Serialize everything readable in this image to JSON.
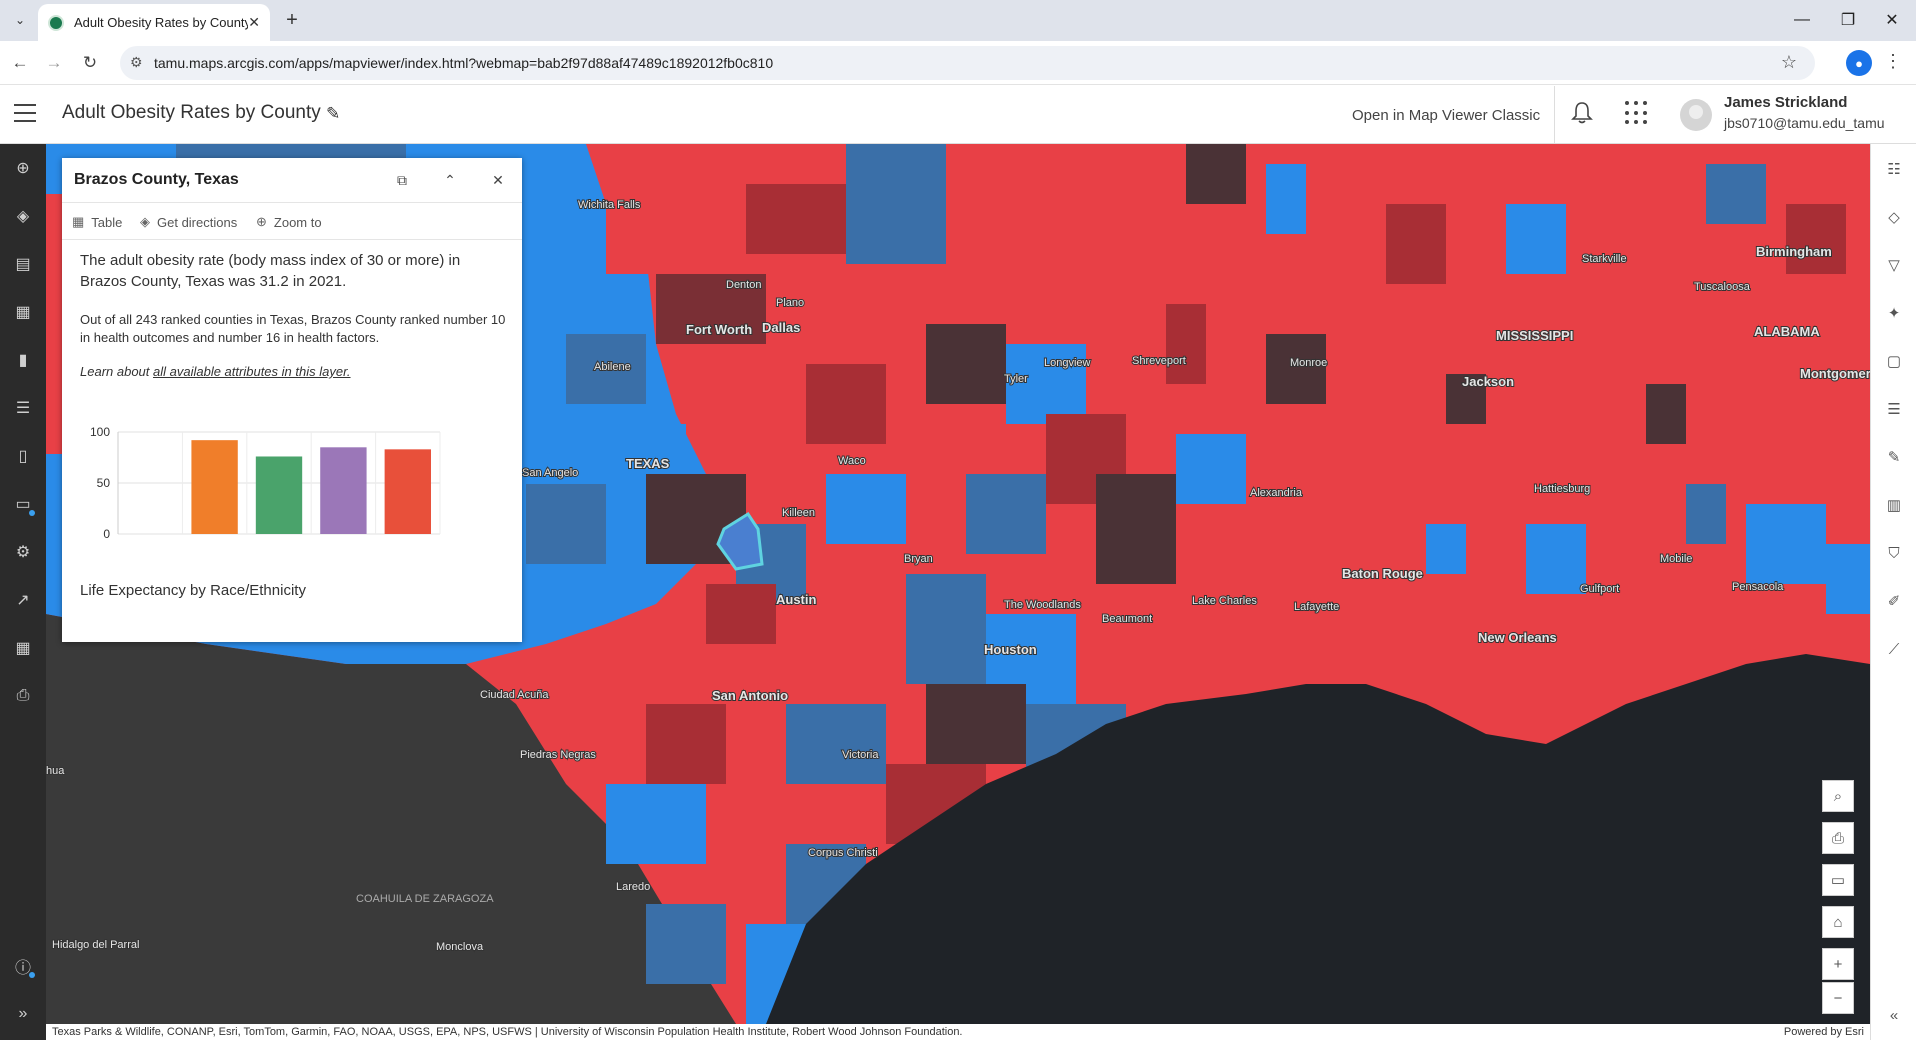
{
  "browser": {
    "tab_title": "Adult Obesity Rates by County",
    "url": "tamu.maps.arcgis.com/apps/mapviewer/index.html?webmap=bab2f97d88af47489c1892012fb0c810",
    "controls": {
      "back": "←",
      "forward": "→",
      "reload": "↻",
      "tab_menu": "⌄",
      "new_tab": "+",
      "close_tab": "✕",
      "minimize": "—",
      "restore": "❐",
      "close": "✕",
      "star": "☆",
      "menu": "⋮"
    }
  },
  "header": {
    "title": "Adult Obesity Rates by County",
    "open_classic": "Open in Map Viewer Classic",
    "user_name": "James Strickland",
    "user_email": "jbs0710@tamu.edu_tamu"
  },
  "left_toolbar": [
    "add-icon",
    "layers-icon",
    "table-icon",
    "basemap-icon",
    "charts-icon",
    "legend-icon",
    "bookmarks-icon",
    "save-icon",
    "settings-icon",
    "share-icon",
    "apps-icon",
    "print-icon",
    "info-icon",
    "expand-icon"
  ],
  "right_toolbar": [
    "properties-icon",
    "styles-icon",
    "filter-icon",
    "effects-icon",
    "popups-icon",
    "labels-icon",
    "edit-icon",
    "analysis-icon",
    "routing-icon",
    "sketch-icon",
    "measure-icon",
    "collapse-icon"
  ],
  "popup": {
    "title": "Brazos County, Texas",
    "actions": {
      "table": "Table",
      "directions": "Get directions",
      "zoom": "Zoom to"
    },
    "text1": "The adult obesity rate (body mass index of 30 or more) in Brazos County, Texas was 31.2  in 2021.",
    "text2": "Out of all 243 ranked counties in Texas, Brazos County ranked number 10 in health outcomes and number 16 in health factors.",
    "text3_prefix": "Learn about ",
    "text3_link": "all available attributes in this layer.",
    "chart_title": "Life Expectancy by Race/Ethnicity"
  },
  "chart_data": {
    "type": "bar",
    "categories": [
      "",
      "",
      "",
      "",
      ""
    ],
    "values": [
      0,
      92,
      76,
      85,
      83
    ],
    "colors": [
      "#ffffff",
      "#f07e2a",
      "#4aa36b",
      "#9b77b8",
      "#e8503a"
    ],
    "yticks": [
      "100",
      "50",
      "0"
    ],
    "ylim": [
      0,
      100
    ],
    "grid": true
  },
  "map_labels": {
    "wichita_falls": "Wichita Falls",
    "denton": "Denton",
    "plano": "Plano",
    "fort_worth": "Fort Worth",
    "dallas": "Dallas",
    "abilene": "Abilene",
    "longview": "Longview",
    "shreveport": "Shreveport",
    "tyler": "Tyler",
    "monroe": "Monroe",
    "mississippi": "MISSISSIPPI",
    "starkville": "Starkville",
    "tuscaloosa": "Tuscaloosa",
    "birmingham": "Birmingham",
    "alabama": "ALABAMA",
    "montgomery": "Montgomery",
    "jackson": "Jackson",
    "san_angelo": "San Angelo",
    "texas": "TEXAS",
    "waco": "Waco",
    "killeen": "Killeen",
    "alexandria": "Alexandria",
    "hattiesburg": "Hattiesburg",
    "bryan": "Bryan",
    "austin": "Austin",
    "the_woodlands": "The Woodlands",
    "houston": "Houston",
    "baton_rouge": "Baton Rouge",
    "lake_charles": "Lake Charles",
    "lafayette": "Lafayette",
    "beaumont": "Beaumont",
    "mobile": "Mobile",
    "pensacola": "Pensacola",
    "gulfport": "Gulfport",
    "new_orleans": "New Orleans",
    "san_antonio": "San Antonio",
    "ciudad_acuna": "Ciudad Acuña",
    "piedras_negras": "Piedras Negras",
    "victoria": "Victoria",
    "corpus_christi": "Corpus Christi",
    "laredo": "Laredo",
    "coahuila": "COAHUILA DE ZARAGOZA",
    "hidalgo": "Hidalgo del Parral",
    "monclova": "Monclova",
    "chihuahua": "hua"
  },
  "attribution": "Texas Parks & Wildlife, CONANP, Esri, TomTom, Garmin, FAO, NOAA, USGS, EPA, NPS, USFWS | University of Wisconsin Population Health Institute, Robert Wood Johnson Foundation.",
  "powered_by": "Powered by Esri",
  "map_controls": {
    "search": "search-icon",
    "print": "print-icon",
    "screen": "screen-icon",
    "home": "home-icon",
    "zoom_in": "+",
    "zoom_out": "−"
  },
  "colors": {
    "high": "#e84046",
    "mid": "#a82e35",
    "dark": "#4a3236",
    "low": "#2a8be8",
    "lowmid": "#3a6fa8",
    "water": "#1f2328",
    "land": "#3a3a3a",
    "selected": "#5fd3e0"
  }
}
